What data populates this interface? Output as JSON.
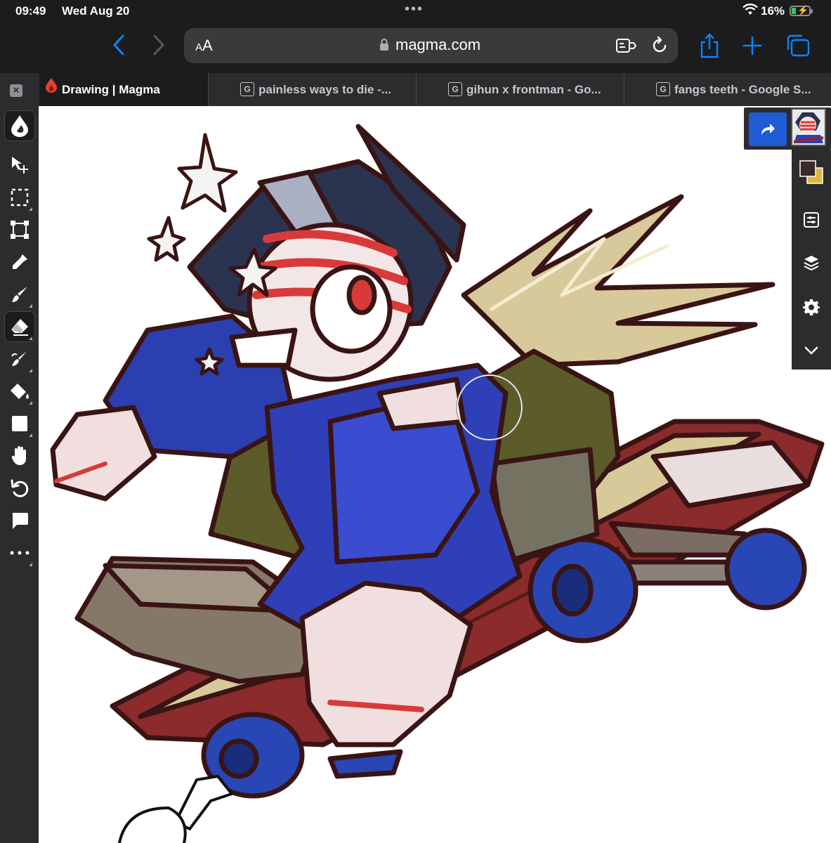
{
  "status_bar": {
    "time": "09:49",
    "date": "Wed Aug 20",
    "multitask_dots": "•••",
    "battery_percent": "16%",
    "battery_level": 0.16,
    "charging": true
  },
  "browser": {
    "text_size_label_small": "A",
    "text_size_label_large": "A",
    "address": "magma.com",
    "icons": [
      "chevron-left-icon",
      "chevron-right-icon",
      "lock-icon",
      "reader-icon",
      "reload-icon",
      "share-icon",
      "plus-icon",
      "tabs-icon"
    ]
  },
  "tabs": [
    {
      "favicon": "magma-icon",
      "title": "Drawing | Magma",
      "active": true
    },
    {
      "favicon": "G",
      "title": "painless ways to die -...",
      "active": false
    },
    {
      "favicon": "G",
      "title": "gihun x frontman - Go...",
      "active": false
    },
    {
      "favicon": "G",
      "title": "fangs teeth - Google S...",
      "active": false
    }
  ],
  "tools": [
    {
      "name": "brush-presets-icon",
      "active": true
    },
    {
      "name": "move-icon"
    },
    {
      "name": "marquee-select-icon"
    },
    {
      "name": "transform-icon"
    },
    {
      "name": "eyedropper-icon"
    },
    {
      "name": "brush-icon"
    },
    {
      "name": "eraser-icon"
    },
    {
      "name": "smudge-icon"
    },
    {
      "name": "fill-bucket-icon"
    },
    {
      "name": "shape-icon"
    },
    {
      "name": "hand-icon"
    },
    {
      "name": "undo-icon"
    },
    {
      "name": "comment-icon"
    },
    {
      "name": "more-icon"
    }
  ],
  "right_panel": {
    "primary_color": "#3a2a2a",
    "secondary_color": "#e3b43a",
    "buttons": [
      "adjustments-icon",
      "layers-icon",
      "settings-icon",
      "collapse-icon"
    ]
  },
  "colors": {
    "redo_button": "#1f5bd6",
    "accent": "#0a84ff"
  }
}
